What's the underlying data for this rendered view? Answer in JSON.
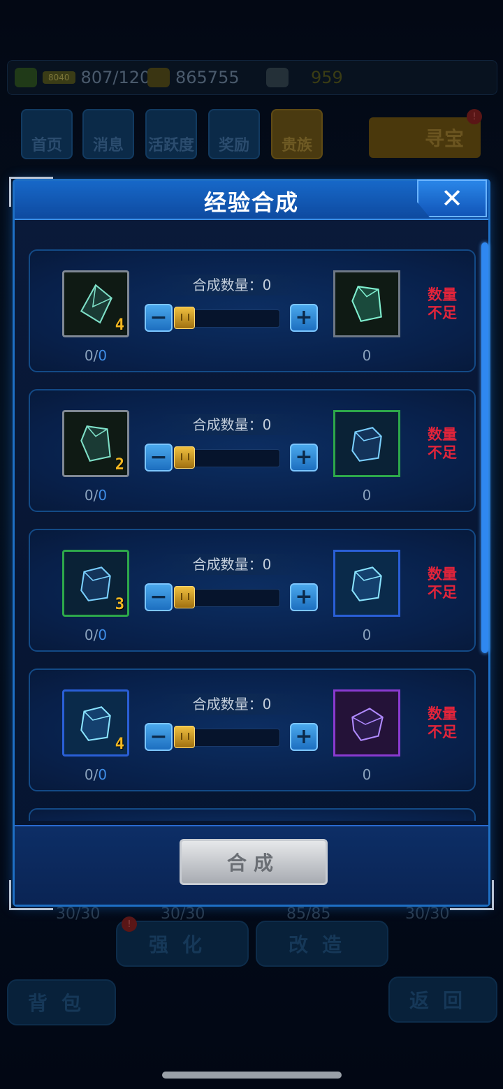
{
  "background": {
    "stamina": "807/120",
    "stamina_tag": "8040",
    "gold": "865755",
    "diamonds": "959",
    "nav": [
      {
        "label": "首页"
      },
      {
        "label": "消息"
      },
      {
        "label": "活跃度"
      },
      {
        "label": "奖励"
      },
      {
        "label": "贵族"
      }
    ],
    "treasure_label": "寻宝",
    "treasure_badge": "!",
    "enhance_label": "强化",
    "modify_label": "改造",
    "bag_label": "背包",
    "back_label": "返回",
    "enhance_badge": "!",
    "stats": [
      "30/30",
      "30/30",
      "85/85",
      "30/30"
    ]
  },
  "modal": {
    "title": "经验合成",
    "compose_label": "合成",
    "rows": [
      {
        "qty_label": "合成数量：0",
        "src_have": "0",
        "src_need": "0",
        "src_level": "4",
        "dst_count": "0",
        "warn": "数量不足"
      },
      {
        "qty_label": "合成数量：0",
        "src_have": "0",
        "src_need": "0",
        "src_level": "2",
        "dst_count": "0",
        "warn": "数量不足"
      },
      {
        "qty_label": "合成数量：0",
        "src_have": "0",
        "src_need": "0",
        "src_level": "3",
        "dst_count": "0",
        "warn": "数量不足"
      },
      {
        "qty_label": "合成数量：0",
        "src_have": "0",
        "src_need": "0",
        "src_level": "4",
        "dst_count": "0",
        "warn": "数量不足"
      }
    ]
  },
  "colors": {
    "accent": "#1e6fc4",
    "warning": "#e2243a",
    "slider_thumb": "#f0c040"
  }
}
